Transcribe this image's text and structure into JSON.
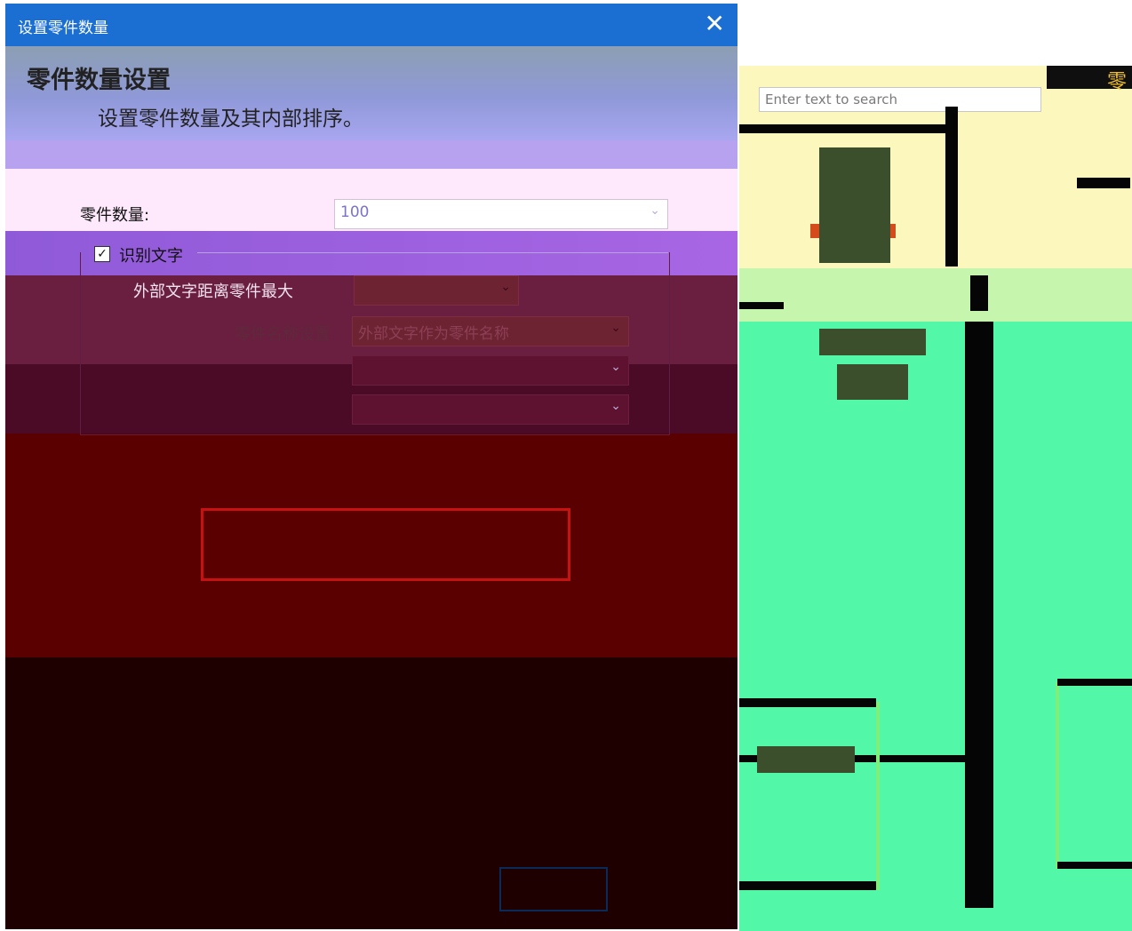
{
  "window": {
    "title": "设置零件数量",
    "close_glyph": "✕"
  },
  "header": {
    "heading": "零件数量设置",
    "subtitle": "设置零件数量及其内部排序。"
  },
  "form": {
    "part_count_label": "零件数量:",
    "part_count_value": "100",
    "recognize_text_label": "识别文字",
    "recognize_text_checked": true,
    "outer_text_distance_label": "外部文字距离零件最大",
    "part_name_setting_label": "零件名称设置",
    "part_name_setting_value": "外部文字作为零件名称"
  },
  "right_panel": {
    "search_placeholder": "Enter text to search",
    "tab_glyph": "零"
  },
  "colors": {
    "titlebar": "#1b6fd2",
    "preview_border": "#c71212",
    "panel_yellow": "#fbf7bd",
    "panel_green": "#52f7a8"
  }
}
